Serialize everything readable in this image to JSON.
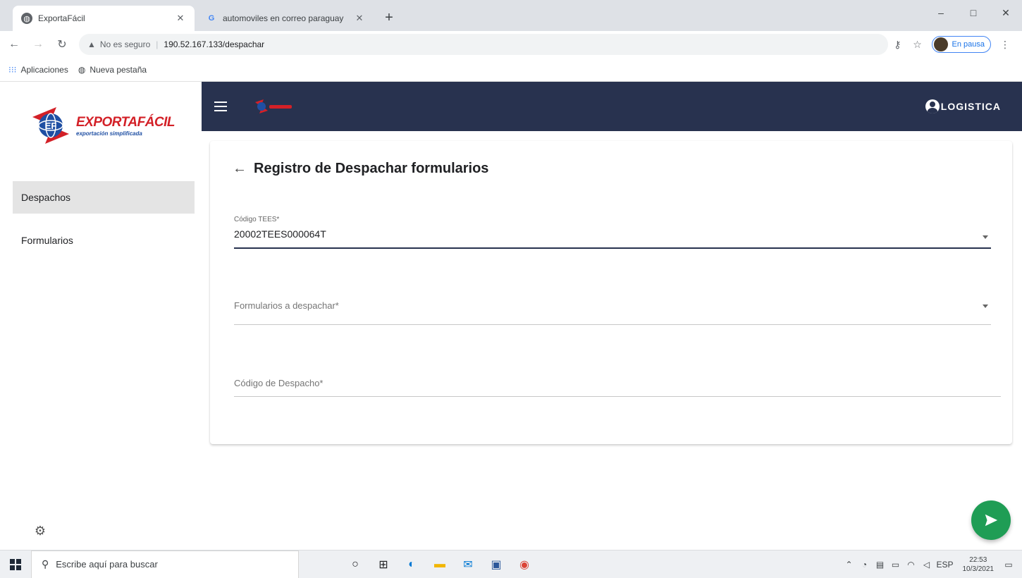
{
  "browser": {
    "tabs": [
      {
        "title": "ExportaFácil",
        "active": true,
        "favicon": "globe-icon"
      },
      {
        "title": "automoviles en correo paraguay",
        "active": false,
        "favicon": "google-icon"
      }
    ],
    "new_tab_symbol": "+",
    "window_controls": {
      "minimize": "–",
      "maximize": "□",
      "close": "✕"
    },
    "security_label": "No es seguro",
    "url": "190.52.167.133/despachar",
    "profile_label": "En pausa",
    "bookmarks": [
      {
        "label": "Aplicaciones",
        "icon": "apps-grid-icon"
      },
      {
        "label": "Nueva pestaña",
        "icon": "globe-icon"
      }
    ]
  },
  "app": {
    "logo": {
      "brand": "EXPORTAFÁCIL",
      "tagline": "exportación simplificada"
    },
    "sidebar": {
      "items": [
        {
          "label": "Despachos",
          "active": true
        },
        {
          "label": "Formularios",
          "active": false
        }
      ]
    },
    "header": {
      "user_label": "LOGISTICA",
      "bar_color": "#28324f"
    },
    "page": {
      "title": "Registro de Despachar formularios",
      "fields": {
        "codigo_tees": {
          "label": "Código TEES*",
          "value": "20002TEES000064T"
        },
        "formularios": {
          "placeholder": "Formularios a despachar*"
        },
        "codigo_despacho": {
          "placeholder": "Código de Despacho*"
        }
      }
    },
    "fab": {
      "icon": "send-icon",
      "color": "#1f9d55"
    }
  },
  "taskbar": {
    "search_placeholder": "Escribe aquí para buscar",
    "language": "ESP",
    "time": "22:53",
    "date": "10/3/2021"
  }
}
